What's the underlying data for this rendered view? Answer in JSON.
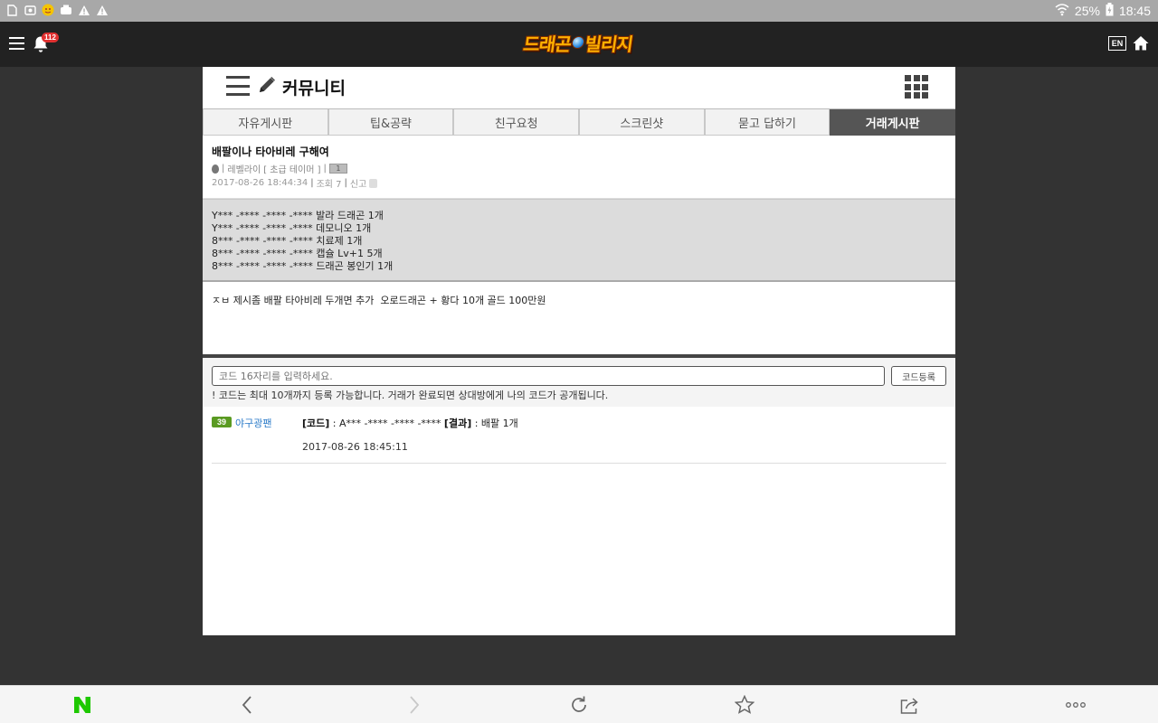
{
  "status_bar": {
    "battery": "25%",
    "time": "18:45"
  },
  "header": {
    "notification_count": "112",
    "logo_text_left": "드래곤",
    "logo_text_right": "빌리지",
    "lang_button": "EN"
  },
  "community": {
    "title": "커뮤니티",
    "tabs": [
      {
        "label": "자유게시판",
        "active": false
      },
      {
        "label": "팁&공략",
        "active": false
      },
      {
        "label": "친구요청",
        "active": false
      },
      {
        "label": "스크린샷",
        "active": false
      },
      {
        "label": "묻고 답하기",
        "active": false
      },
      {
        "label": "거래게시판",
        "active": true
      }
    ]
  },
  "post": {
    "title": "배팔이나 타아비레 구해여",
    "author_name": "레벨라이",
    "author_rank": "[ 초급 테이머 ]",
    "author_level": "1",
    "datetime": "2017-08-26 18:44:34",
    "views": "조회 7",
    "report": "신고",
    "codes": [
      "Y*** -**** -**** -**** 발라 드래곤 1개",
      "Y*** -**** -**** -**** 데모니오 1개",
      "8*** -**** -**** -**** 치료제 1개",
      "8*** -**** -**** -**** 캡슐 Lv+1 5개",
      "8*** -**** -**** -**** 드래곤 봉인기 1개"
    ],
    "body": "ㅈㅂ 제시좀 배팔 타아비레 두개면 추가  오로드래곤 + 황다 10개 골드 100만원"
  },
  "code_entry": {
    "placeholder": "코드 16자리를 입력하세요.",
    "button": "코드등록",
    "notice": "! 코드는 최대 10개까지 등록 가능합니다. 거래가 완료되면 상대방에게 나의 코드가 공개됩니다."
  },
  "comments": [
    {
      "level": "39",
      "user": "야구광팬",
      "code_label": "[코드]",
      "code_value": ": A*** -**** -**** -****",
      "result_label": "[결과]",
      "result_value": ": 배팔 1개",
      "date": "2017-08-26 18:45:11"
    }
  ],
  "colors": {
    "active_tab": "#555555",
    "user_link": "#2a7ac8",
    "level_badge": "#5a9a22",
    "naver_green": "#1ec800"
  }
}
